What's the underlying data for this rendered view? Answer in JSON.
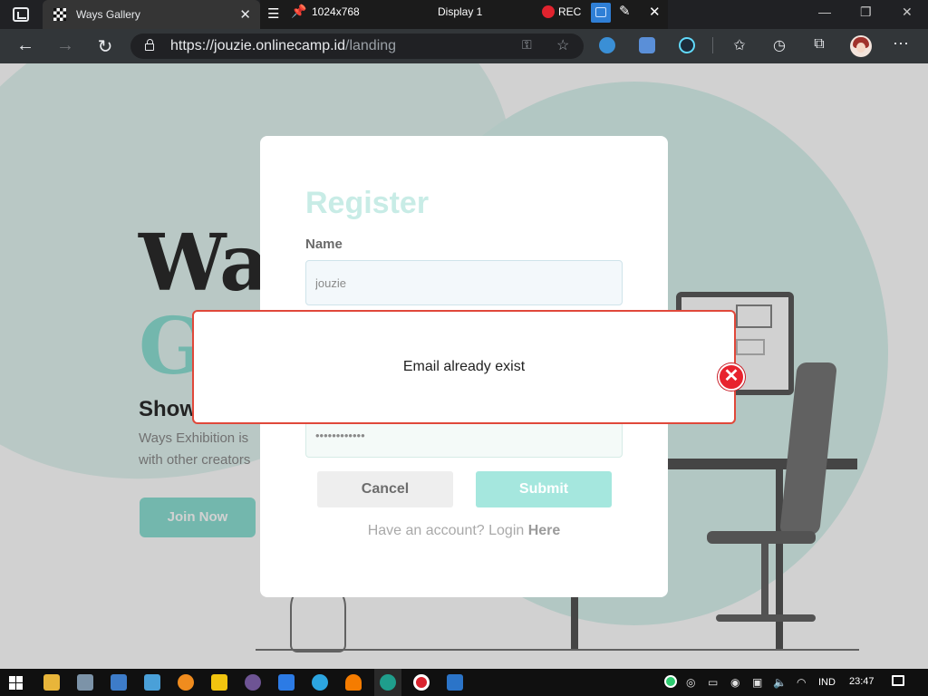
{
  "browser": {
    "tab_title": "Ways Gallery",
    "tab_close": "✕",
    "url_base": "https://jouzie.onlinecamp.id",
    "url_path": "/landing"
  },
  "recorder": {
    "resolution": "1024x768",
    "display": "Display 1",
    "rec_label": "REC"
  },
  "landing": {
    "hero_line1": "Wa",
    "hero_line2": "G",
    "showcase": "Show",
    "description": "Ways Exhibition is with other creators",
    "join_button": "Join Now"
  },
  "register_modal": {
    "title": "Register",
    "name_label": "Name",
    "name_value": "jouzie",
    "password_value": "••••••••••••",
    "cancel_button": "Cancel",
    "submit_button": "Submit",
    "have_account": "Have an account? Login ",
    "login_link": "Here"
  },
  "alert": {
    "message": "Email already exist",
    "close_icon": "close-icon"
  },
  "taskbar": {
    "language": "IND",
    "time": "23:47"
  },
  "colors": {
    "accent": "#8de0d4",
    "error": "#e0483a"
  }
}
